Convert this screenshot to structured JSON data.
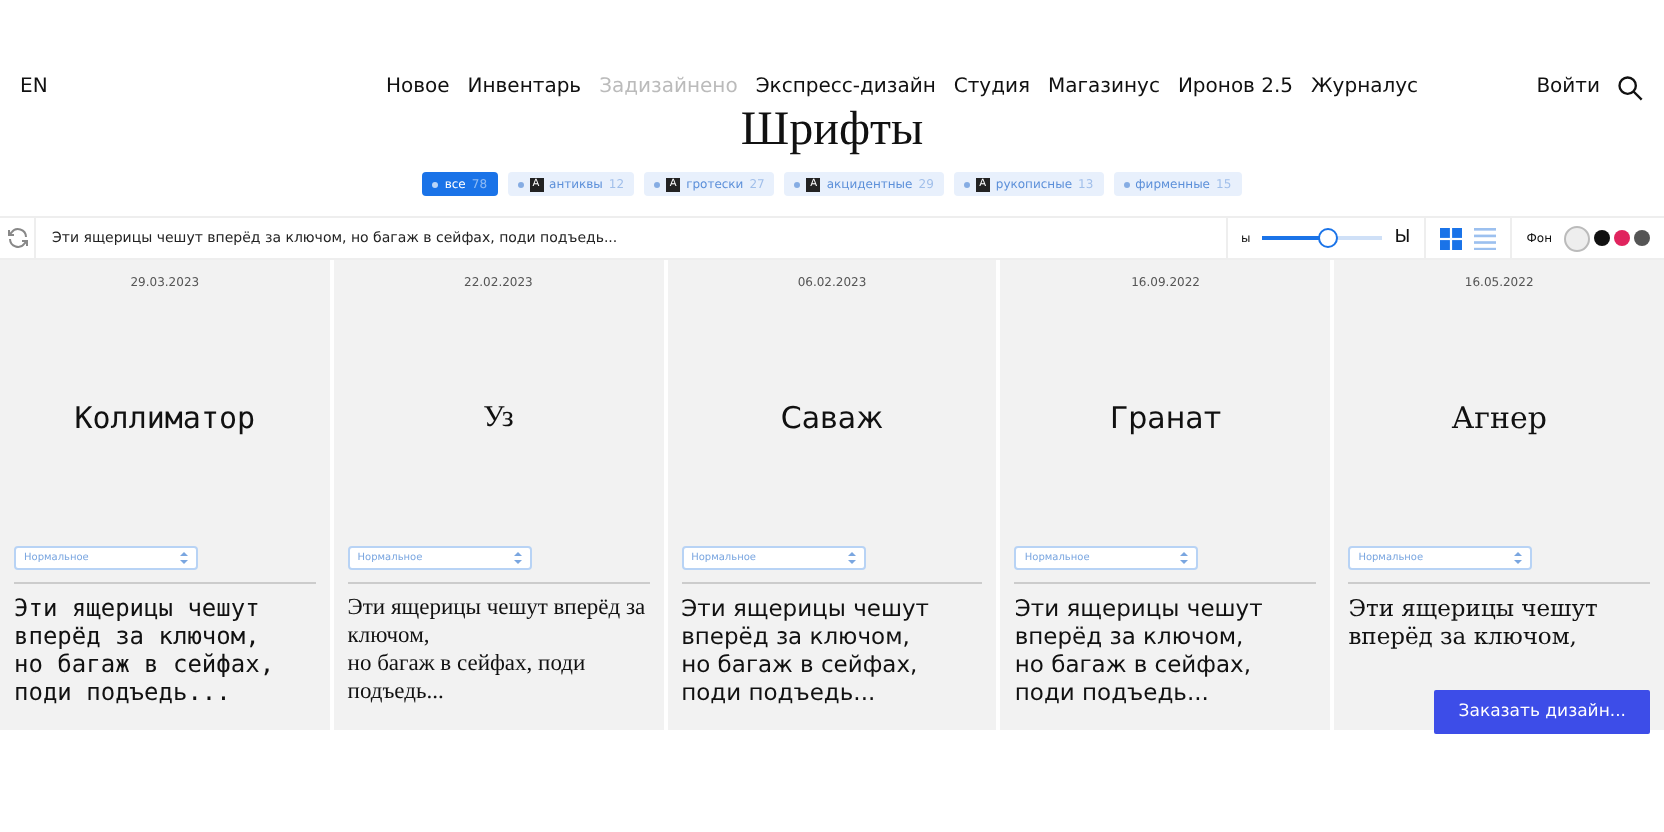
{
  "header": {
    "language": "EN",
    "nav": [
      {
        "label": "Новое",
        "disabled": false
      },
      {
        "label": "Инвентарь",
        "disabled": false
      },
      {
        "label": "Задизайнено",
        "disabled": true
      },
      {
        "label": "Экспресс-дизайн",
        "disabled": false
      },
      {
        "label": "Студия",
        "disabled": false
      },
      {
        "label": "Магазинус",
        "disabled": false
      },
      {
        "label": "Иронов 2.5",
        "disabled": false
      },
      {
        "label": "Журналус",
        "disabled": false
      }
    ],
    "login": "Войти"
  },
  "title": "Шрифты",
  "filters": [
    {
      "label": "все",
      "count": "78",
      "selected": true
    },
    {
      "label": "антиквы",
      "count": "12",
      "glyph": "A",
      "selected": false
    },
    {
      "label": "гротески",
      "count": "27",
      "glyph": "A",
      "selected": false
    },
    {
      "label": "акцидентные",
      "count": "29",
      "glyph": "A",
      "selected": false
    },
    {
      "label": "рукописные",
      "count": "13",
      "glyph": "A",
      "selected": false
    },
    {
      "label": "фирменные",
      "count": "15",
      "selected": false
    }
  ],
  "toolbar": {
    "sample_value": "Эти ящерицы чешут вперёд за ключом, но багаж в сейфах, поди подъедь...",
    "size_min": "ы",
    "size_max": "Ы",
    "size": {
      "level": 0.55
    },
    "views": [
      {
        "kind": "grid",
        "selected": true
      },
      {
        "kind": "list",
        "selected": false
      }
    ],
    "background_label": "Фон",
    "backgrounds": [
      {
        "color": "#eeeeee",
        "selected": true
      },
      {
        "color": "#111111",
        "selected": false
      },
      {
        "color": "#e0245e",
        "selected": false
      },
      {
        "color": "#555555",
        "selected": false
      }
    ]
  },
  "fonts": [
    {
      "date": "29.03.2023",
      "name": "Коллиматор",
      "kind": "mono",
      "weight": "Нормальное",
      "sample": "Эти ящерицы чешут вперёд за ключом,\nно багаж в сейфах, поди подъедь..."
    },
    {
      "date": "22.02.2023",
      "name": "Уз",
      "kind": "serif",
      "weight": "Нормальное",
      "sample": "Эти ящерицы чешут вперёд за ключом,\nно багаж в сейфах, поди подъедь..."
    },
    {
      "date": "06.02.2023",
      "name": "Саваж",
      "kind": "sans",
      "weight": "Нормальное",
      "sample": "Эти ящерицы чешут вперёд за ключом,\nно багаж в сейфах, поди подъедь..."
    },
    {
      "date": "16.09.2022",
      "name": "Гранат",
      "kind": "sans",
      "weight": "Нормальное",
      "sample": "Эти ящерицы чешут вперёд за ключом,\nно багаж в сейфах, поди подъедь..."
    },
    {
      "date": "16.05.2022",
      "name": "Агнер",
      "kind": "slab",
      "weight": "Нормальное",
      "sample": "Эти ящерицы чешут вперёд за ключом,"
    }
  ],
  "order_button": "Заказать дизайн..."
}
